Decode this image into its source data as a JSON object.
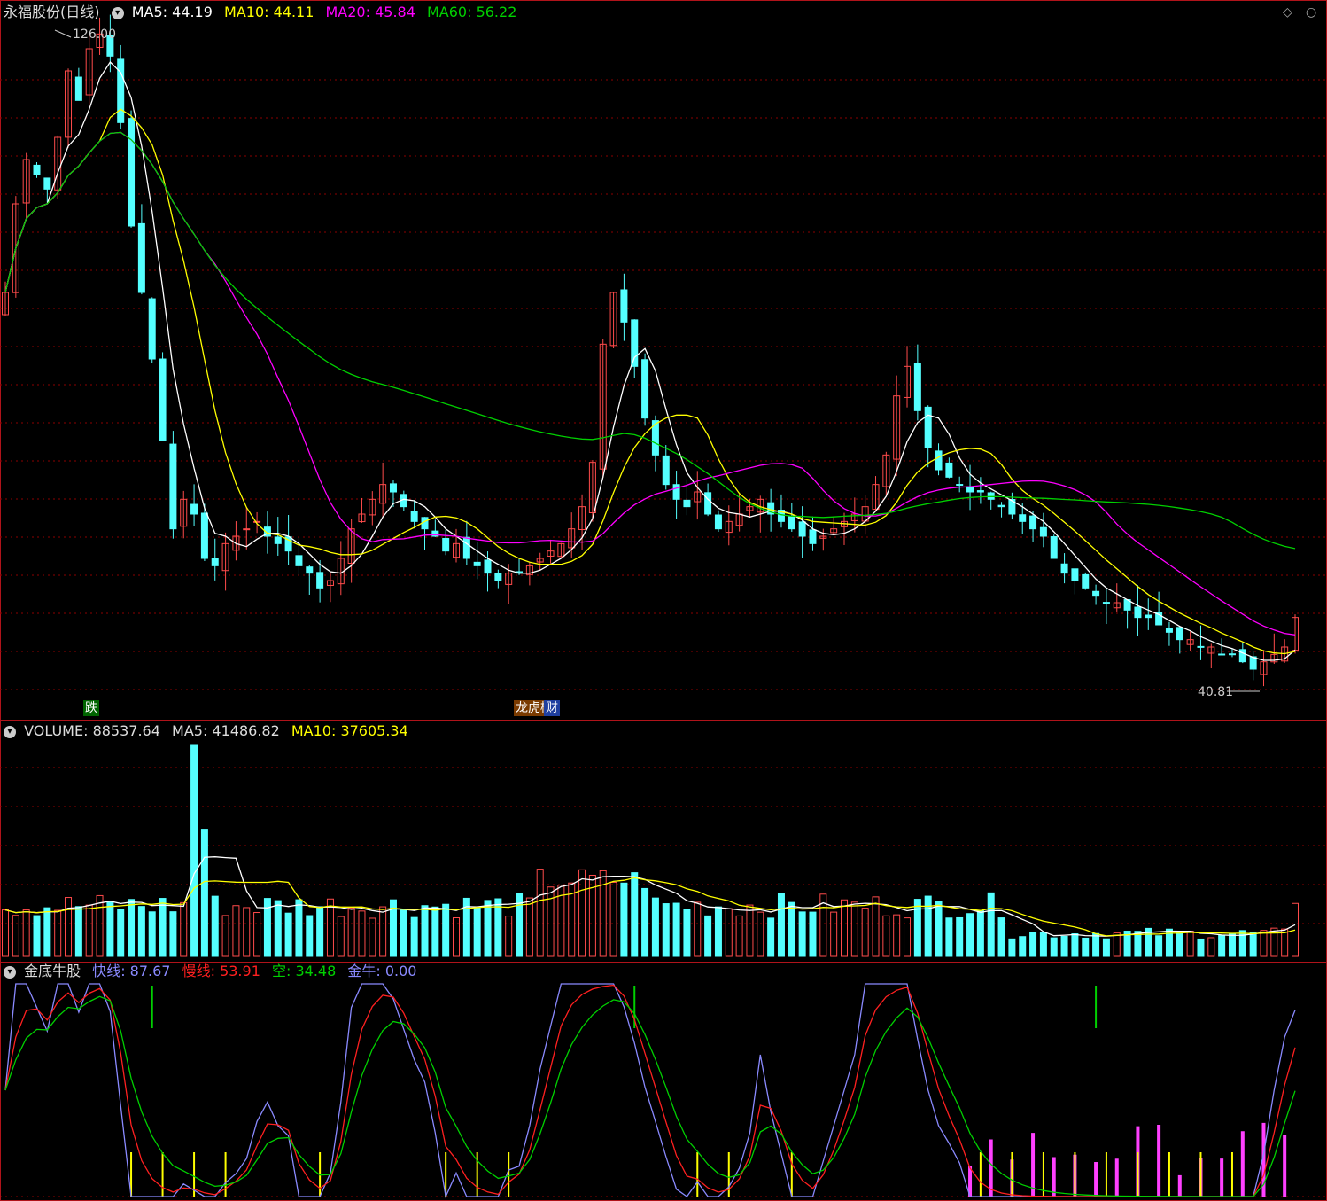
{
  "stock": {
    "name": "永福股份",
    "period": "(日线)"
  },
  "main_panel": {
    "ma5": "MA5: 44.19",
    "ma10": "MA10: 44.11",
    "ma20": "MA20: 45.84",
    "ma60": "MA60: 56.22",
    "high_label": "126.00",
    "low_label": "40.81",
    "tags": [
      "跌",
      "龙虎榜",
      "财"
    ]
  },
  "volume_panel": {
    "volume": "VOLUME: 88537.64",
    "ma5": "MA5: 41486.82",
    "ma10": "MA10: 37605.34"
  },
  "indicator_panel": {
    "name": "金底牛股",
    "fast": "快线: 87.67",
    "slow": "慢线: 53.91",
    "empty": "空: 34.48",
    "gold": "金牛: 0.00"
  },
  "colors": {
    "up": "#ff4b4b",
    "down": "#54ffff",
    "ma5": "#ffffff",
    "ma10": "#ffff00",
    "ma20": "#ff00ff",
    "ma60": "#00d000",
    "grid": "#8b0000",
    "fast": "#8a8aff",
    "slow": "#ff2020",
    "empty": "#00d000",
    "bar_magenta": "#ff40ff",
    "bar_yellow": "#ffff00",
    "bar_green": "#00d000"
  },
  "chart_data": {
    "type": "candlestick",
    "price_range": [
      40.81,
      126.0
    ],
    "candles_close": [
      92,
      104,
      110,
      108,
      106,
      113,
      122,
      118,
      125,
      127,
      124,
      115,
      101,
      92,
      83,
      72,
      60,
      64,
      62,
      56,
      55,
      58,
      59,
      60,
      61,
      59,
      58,
      57,
      55,
      54,
      52,
      53,
      56,
      60,
      62,
      64,
      66,
      65,
      63,
      61,
      60,
      59,
      57,
      58,
      56,
      55,
      54,
      53,
      54,
      54,
      55,
      56,
      57,
      58,
      60,
      63,
      69,
      85,
      92,
      88,
      82,
      75,
      70,
      66,
      64,
      63,
      65,
      62,
      60,
      61,
      62,
      63,
      64,
      62,
      61,
      60,
      59,
      58,
      59,
      60,
      61,
      62,
      63,
      66,
      70,
      78,
      82,
      76,
      71,
      68,
      67,
      66,
      65,
      65,
      64,
      63,
      62,
      61,
      60,
      59,
      56,
      54,
      53,
      52,
      51,
      50,
      50,
      49,
      48,
      48,
      47,
      46,
      45,
      45,
      44,
      44,
      43,
      43,
      42,
      41,
      42,
      43,
      44,
      48
    ],
    "volume_range": [
      0,
      88537.64
    ],
    "volume_ma5": 41486.82,
    "volume_ma10": 37605.34,
    "indicator": {
      "fast": 87.67,
      "slow": 53.91,
      "empty": 34.48,
      "gold": 0.0
    }
  }
}
